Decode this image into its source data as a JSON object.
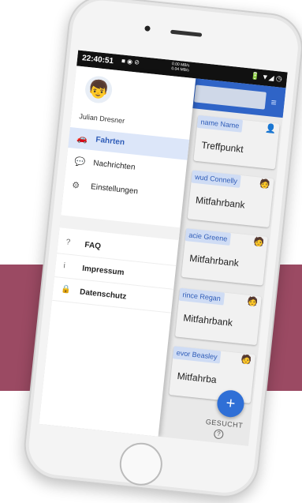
{
  "status_bar": {
    "time": "22:40:51",
    "speed": "0.00 MB/s\n0.04 MB/s",
    "right_icons": "🔋 ▼◢ ◷"
  },
  "drawer": {
    "user_name": "Julian Dresner",
    "avatar_icon": "person-avatar-icon",
    "main_items": [
      {
        "label": "Fahrten",
        "icon": "car-icon",
        "active": true
      },
      {
        "label": "Nachrichten",
        "icon": "chat-bubble-icon",
        "active": false
      },
      {
        "label": "Einstellungen",
        "icon": "gear-icon",
        "active": false
      }
    ],
    "secondary_items": [
      {
        "label": "FAQ",
        "icon": "question-icon"
      },
      {
        "label": "Impressum",
        "icon": "info-icon"
      },
      {
        "label": "Datenschutz",
        "icon": "lock-icon"
      }
    ]
  },
  "list": {
    "cards": [
      {
        "name": "name Name",
        "place": "Treffpunkt"
      },
      {
        "name": "wud Connelly",
        "place": "Mitfahrbank"
      },
      {
        "name": "acie Greene",
        "place": "Mitfahrbank"
      },
      {
        "name": "rince Regan",
        "place": "Mitfahrbank"
      },
      {
        "name": "evor Beasley",
        "place": "Mitfahrba"
      }
    ],
    "sought_label": "GESUCHT",
    "fab_label": "+"
  },
  "colors": {
    "primary": "#2f64c7",
    "band": "#9b4a63",
    "active_bg": "#dce6f9"
  }
}
